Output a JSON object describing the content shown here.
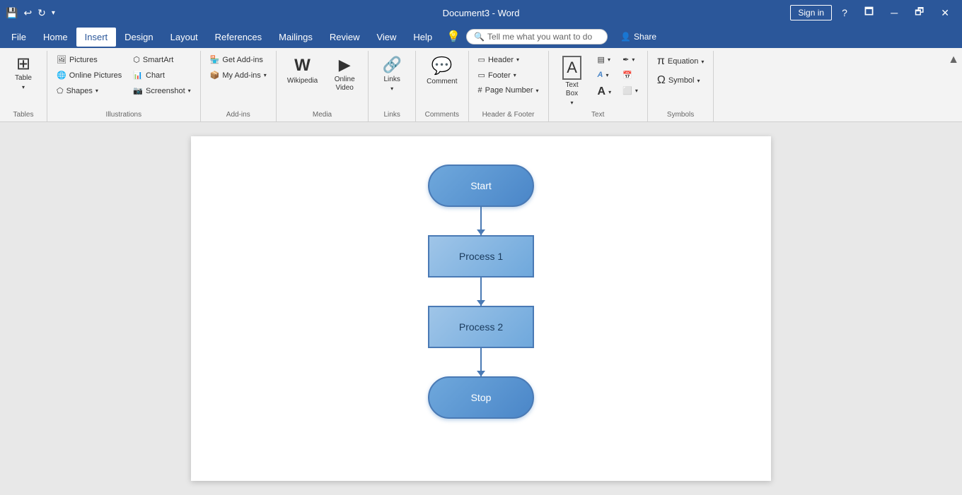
{
  "titleBar": {
    "title": "Document3 - Word",
    "qatIcons": [
      "💾",
      "↩",
      "↻",
      "▾"
    ],
    "signInLabel": "Sign in",
    "windowButtons": [
      "🗖",
      "─",
      "🗗",
      "✕"
    ]
  },
  "menuBar": {
    "items": [
      {
        "id": "file",
        "label": "File"
      },
      {
        "id": "home",
        "label": "Home"
      },
      {
        "id": "insert",
        "label": "Insert",
        "active": true
      },
      {
        "id": "design",
        "label": "Design"
      },
      {
        "id": "layout",
        "label": "Layout"
      },
      {
        "id": "references",
        "label": "References"
      },
      {
        "id": "mailings",
        "label": "Mailings"
      },
      {
        "id": "review",
        "label": "Review"
      },
      {
        "id": "view",
        "label": "View"
      },
      {
        "id": "help",
        "label": "Help"
      }
    ],
    "tellMe": "Tell me what you want to do",
    "share": "Share"
  },
  "ribbon": {
    "groups": [
      {
        "id": "tables",
        "label": "Tables",
        "buttons": [
          {
            "id": "table",
            "icon": "⊞",
            "label": "Table",
            "large": true,
            "dropdown": true
          }
        ]
      },
      {
        "id": "illustrations",
        "label": "Illustrations",
        "columns": [
          {
            "buttons": [
              {
                "id": "pictures",
                "icon": "🖼",
                "label": "Pictures",
                "small": true
              },
              {
                "id": "online-pictures",
                "icon": "🌐",
                "label": "Online Pictures",
                "small": true
              },
              {
                "id": "shapes",
                "icon": "⬠",
                "label": "Shapes",
                "small": true,
                "dropdown": true
              }
            ]
          },
          {
            "buttons": [
              {
                "id": "smartart",
                "icon": "⬡",
                "label": "SmartArt",
                "small": true
              },
              {
                "id": "chart",
                "icon": "📊",
                "label": "Chart",
                "small": true
              },
              {
                "id": "screenshot",
                "icon": "📷",
                "label": "Screenshot",
                "small": true,
                "dropdown": true
              }
            ]
          }
        ]
      },
      {
        "id": "addins",
        "label": "Add-ins",
        "columns": [
          {
            "buttons": [
              {
                "id": "get-addins",
                "icon": "🏪",
                "label": "Get Add-ins",
                "small": true
              },
              {
                "id": "my-addins",
                "icon": "📦",
                "label": "My Add-ins",
                "small": true,
                "dropdown": true
              }
            ]
          }
        ]
      },
      {
        "id": "media",
        "label": "Media",
        "buttons": [
          {
            "id": "wikipedia",
            "icon": "W",
            "label": "Wikipedia",
            "large": true
          },
          {
            "id": "online-video",
            "icon": "▶",
            "label": "Online Video",
            "large": true
          }
        ]
      },
      {
        "id": "links",
        "label": "Links",
        "buttons": [
          {
            "id": "links-btn",
            "icon": "🔗",
            "label": "Links",
            "large": true,
            "dropdown": true
          }
        ]
      },
      {
        "id": "comments",
        "label": "Comments",
        "buttons": [
          {
            "id": "comment",
            "icon": "💬",
            "label": "Comment",
            "large": true
          }
        ]
      },
      {
        "id": "header-footer",
        "label": "Header & Footer",
        "columns": [
          {
            "buttons": [
              {
                "id": "header",
                "icon": "▭",
                "label": "Header",
                "small": true,
                "dropdown": true
              },
              {
                "id": "footer",
                "icon": "▭",
                "label": "Footer",
                "small": true,
                "dropdown": true
              },
              {
                "id": "page-number",
                "icon": "#",
                "label": "Page Number",
                "small": true,
                "dropdown": true
              }
            ]
          }
        ]
      },
      {
        "id": "text",
        "label": "Text",
        "columns": [
          {
            "buttons": [
              {
                "id": "text-box",
                "icon": "A",
                "label": "Text Box",
                "large": true,
                "dropdown": true
              }
            ]
          },
          {
            "buttons": [
              {
                "id": "quick-parts",
                "icon": "▤",
                "label": "",
                "small": true
              },
              {
                "id": "wordart",
                "icon": "A",
                "label": "",
                "small": true
              },
              {
                "id": "dropcap",
                "icon": "A",
                "label": "",
                "small": true
              }
            ]
          },
          {
            "buttons": [
              {
                "id": "sig-line",
                "icon": "✒",
                "label": "",
                "small": true
              },
              {
                "id": "date-time",
                "icon": "📅",
                "label": "",
                "small": true
              },
              {
                "id": "object",
                "icon": "⬜",
                "label": "",
                "small": true
              }
            ]
          }
        ]
      },
      {
        "id": "symbols",
        "label": "Symbols",
        "columns": [
          {
            "buttons": [
              {
                "id": "equation",
                "icon": "π",
                "label": "Equation",
                "small": true,
                "dropdown": true
              },
              {
                "id": "symbol",
                "icon": "Ω",
                "label": "Symbol",
                "small": true,
                "dropdown": true
              }
            ]
          }
        ]
      }
    ]
  },
  "flowchart": {
    "nodes": [
      {
        "id": "start",
        "type": "oval",
        "label": "Start"
      },
      {
        "id": "process1",
        "type": "rect",
        "label": "Process 1"
      },
      {
        "id": "process2",
        "type": "rect",
        "label": "Process 2"
      },
      {
        "id": "stop",
        "type": "oval",
        "label": "Stop"
      }
    ]
  }
}
